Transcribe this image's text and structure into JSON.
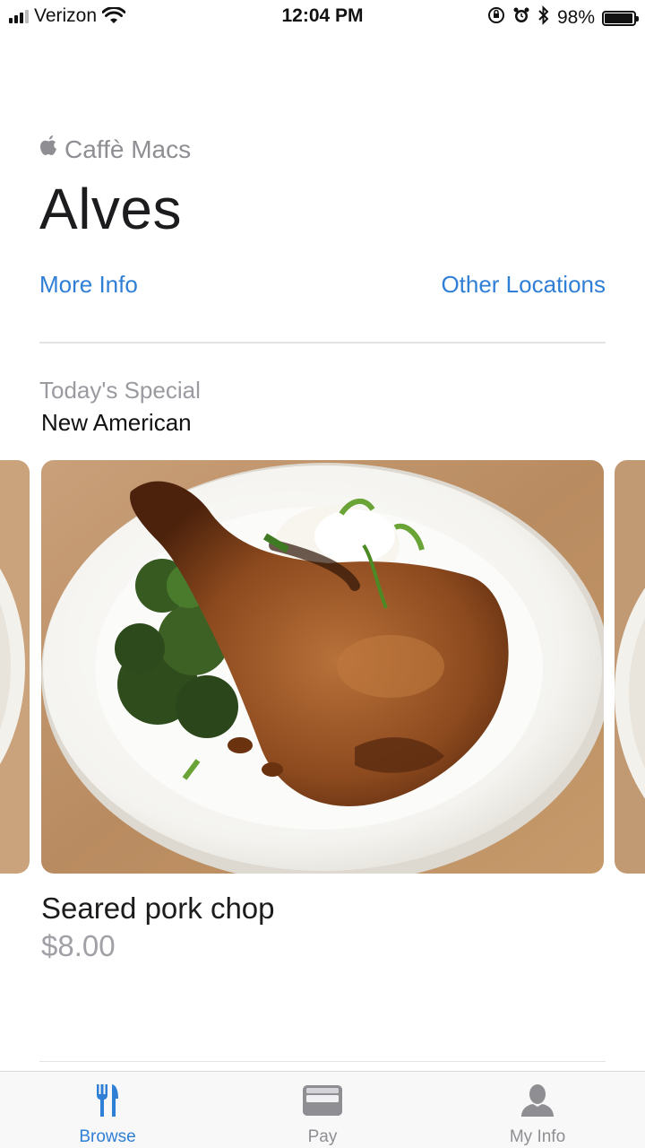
{
  "status_bar": {
    "carrier": "Verizon",
    "time": "12:04 PM",
    "battery_percent": "98%",
    "battery_level": 0.98
  },
  "header": {
    "brand": "Caffè Macs",
    "title": "Alves",
    "more_info_label": "More Info",
    "other_locations_label": "Other Locations"
  },
  "special": {
    "label": "Today's Special",
    "cuisine": "New American",
    "dish_name": "Seared pork chop",
    "price": "$8.00"
  },
  "tab_bar": {
    "tabs": [
      {
        "label": "Browse",
        "icon": "fork-knife-icon",
        "active": true
      },
      {
        "label": "Pay",
        "icon": "wallet-icon",
        "active": false
      },
      {
        "label": "My Info",
        "icon": "person-icon",
        "active": false
      }
    ]
  },
  "colors": {
    "accent": "#2f7fd6",
    "secondary_text": "#8e8e93"
  }
}
